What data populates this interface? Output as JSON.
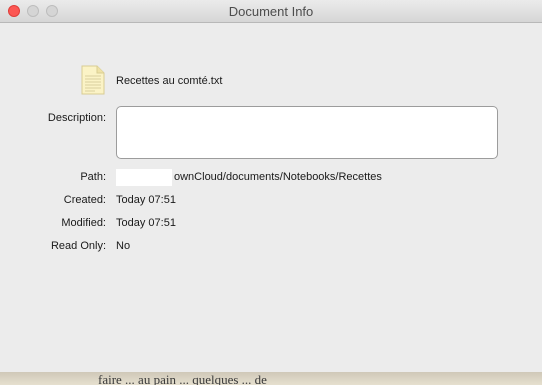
{
  "window": {
    "title": "Document Info"
  },
  "file": {
    "name": "Recettes au comté.txt",
    "icon": "text-document-icon"
  },
  "fields": {
    "description_label": "Description:",
    "description_value": "",
    "path_label": "Path:",
    "path_value": "ownCloud/documents/Notebooks/Recettes",
    "created_label": "Created:",
    "created_value": "Today 07:51",
    "modified_label": "Modified:",
    "modified_value": "Today 07:51",
    "readonly_label": "Read Only:",
    "readonly_value": "No"
  },
  "background_text": "faire ... au pain ... quelques ... de",
  "colors": {
    "close_button": "#fc5753",
    "window_bg": "#ececec"
  }
}
